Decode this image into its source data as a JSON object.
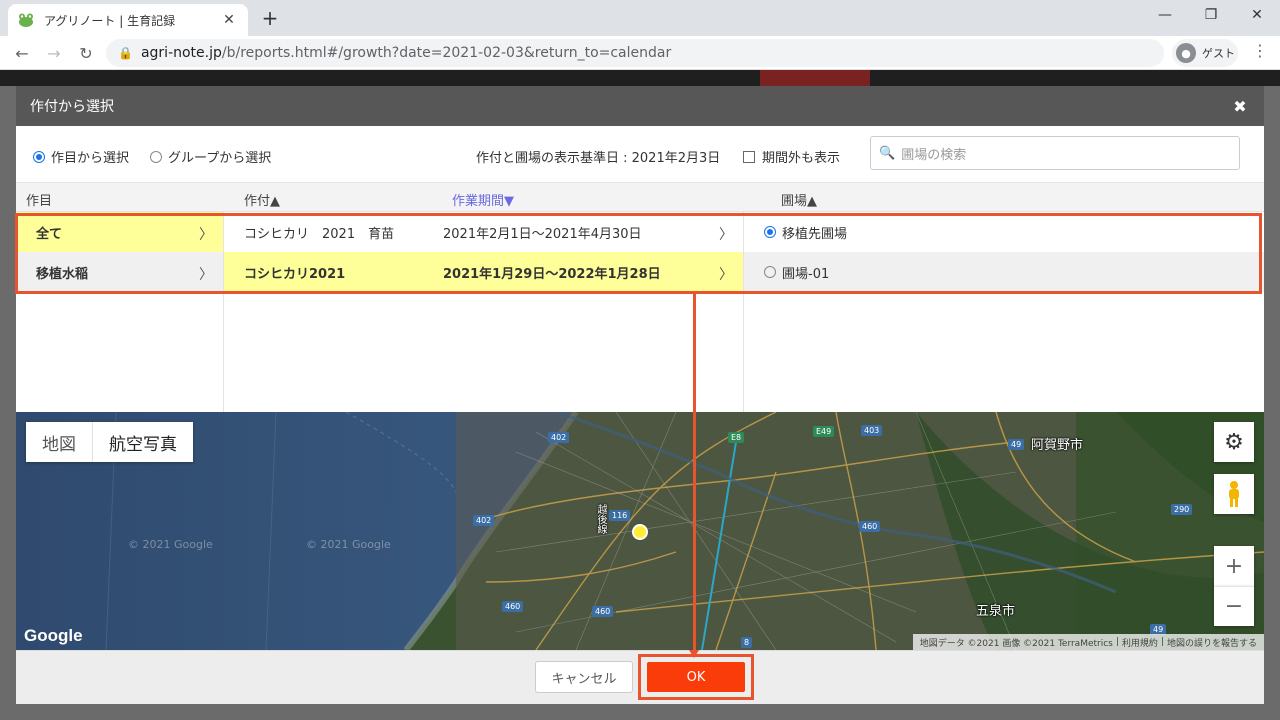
{
  "browser": {
    "tab_title": "アグリノート | 生育記録",
    "url_host": "agri-note.jp",
    "url_path": "/b/reports.html#/growth?date=2021-02-03&return_to=calendar",
    "profile_label": "ゲスト"
  },
  "modal": {
    "title": "作付から選択",
    "filters": {
      "radio_crop": "作目から選択",
      "radio_group": "グループから選択",
      "base_date": "作付と圃場の表示基準日 : 2021年2月3日",
      "show_out_of_period": "期間外も表示",
      "search_placeholder": "圃場の検索"
    },
    "columns": {
      "crop": "作目",
      "planting": "作付▲",
      "period": "作業期間▼",
      "field": "圃場▲"
    },
    "crops": [
      "全て",
      "移植水稲"
    ],
    "plantings": [
      {
        "name": "コシヒカリ　2021　育苗",
        "period": "2021年2月1日～2021年4月30日"
      },
      {
        "name": "コシヒカリ2021",
        "period": "2021年1月29日～2022年1月28日"
      }
    ],
    "fields": [
      "移植先圃場",
      "圃場-01"
    ],
    "map": {
      "type_map": "地図",
      "type_aerial": "航空写真",
      "google": "Google",
      "attribution": [
        "地図データ ©2021 画像 ©2021 TerraMetrics",
        "利用規約",
        "地図の誤りを報告する"
      ],
      "labels": [
        "阿賀野市",
        "五泉市",
        "越後線"
      ],
      "watermark": "© 2021 Google",
      "road_numbers": [
        "402",
        "116",
        "460",
        "403",
        "49",
        "290",
        "E8",
        "E49",
        "8"
      ]
    },
    "footer": {
      "cancel": "キャンセル",
      "ok": "OK"
    }
  },
  "colors": {
    "accent_red": "#fa3b0a",
    "highlight_yellow": "#ffff99",
    "annotation": "#e8542e"
  }
}
